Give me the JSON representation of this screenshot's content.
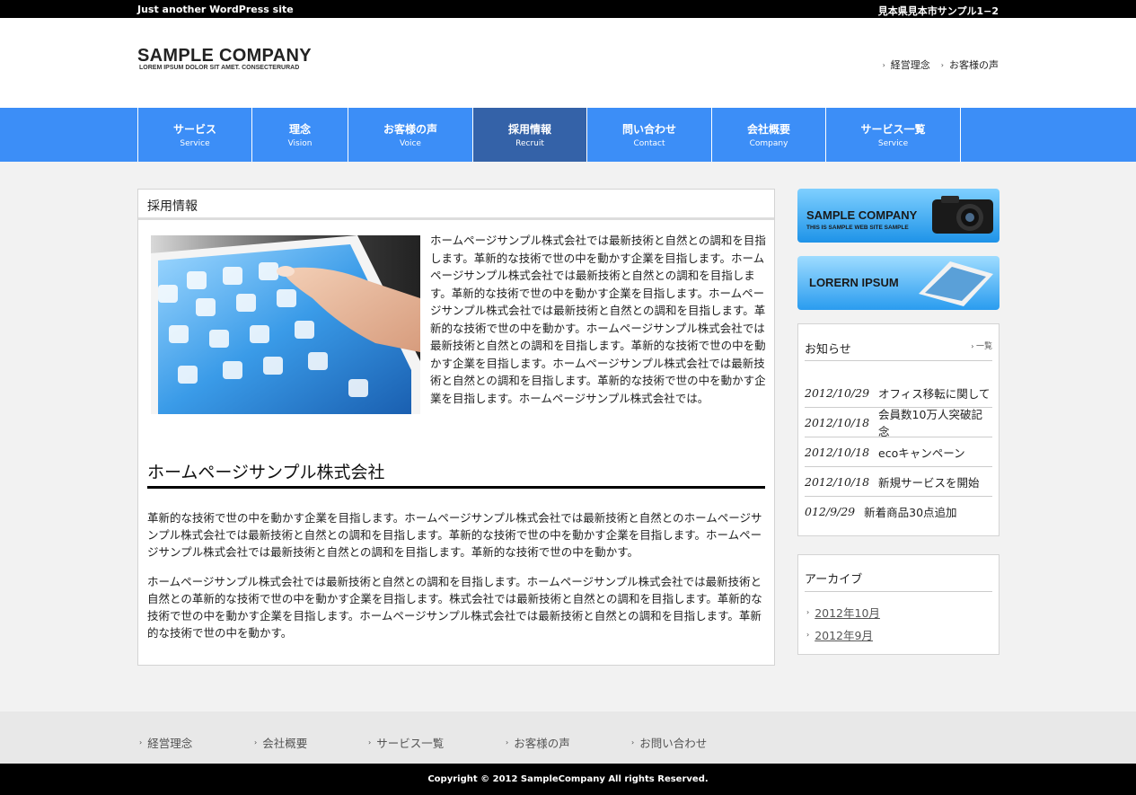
{
  "topbar": {
    "tagline": "Just another WordPress site",
    "address": "見本県見本市サンプル1−2"
  },
  "header": {
    "logo": "SAMPLE COMPANY",
    "logo_sub": "LOREM IPSUM DOLOR SIT AMET. CONSECTERURAD",
    "links": [
      {
        "label": "経営理念"
      },
      {
        "label": "お客様の声"
      }
    ]
  },
  "nav": [
    {
      "jp": "サービス",
      "en": "Service"
    },
    {
      "jp": "理念",
      "en": "Vision"
    },
    {
      "jp": "お客様の声",
      "en": "Voice"
    },
    {
      "jp": "採用情報",
      "en": "Recruit"
    },
    {
      "jp": "問い合わせ",
      "en": "Contact"
    },
    {
      "jp": "会社概要",
      "en": "Company"
    },
    {
      "jp": "サービス一覧",
      "en": "Service"
    }
  ],
  "main": {
    "title": "採用情報",
    "intro": "ホームページサンプル株式会社では最新技術と自然との調和を目指します。革新的な技術で世の中を動かす企業を目指します。ホームページサンプル株式会社では最新技術と自然との調和を目指します。革新的な技術で世の中を動かす企業を目指します。ホームページサンプル株式会社では最新技術と自然との調和を目指します。革新的な技術で世の中を動かす。ホームページサンプル株式会社では最新技術と自然との調和を目指します。革新的な技術で世の中を動かす企業を目指します。ホームページサンプル株式会社では最新技術と自然との調和を目指します。革新的な技術で世の中を動かす企業を目指します。ホームページサンプル株式会社では。",
    "heading": "ホームページサンプル株式会社",
    "para1": "革新的な技術で世の中を動かす企業を目指します。ホームページサンプル株式会社では最新技術と自然とのホームページサンプル株式会社では最新技術と自然との調和を目指します。革新的な技術で世の中を動かす企業を目指します。ホームページサンプル株式会社では最新技術と自然との調和を目指します。革新的な技術で世の中を動かす。",
    "para2": "ホームページサンプル株式会社では最新技術と自然との調和を目指します。ホームページサンプル株式会社では最新技術と自然との革新的な技術で世の中を動かす企業を目指します。株式会社では最新技術と自然との調和を目指します。革新的な技術で世の中を動かす企業を目指します。ホームページサンプル株式会社では最新技術と自然との調和を目指します。革新的な技術で世の中を動かす。"
  },
  "banners": {
    "b1_title": "SAMPLE COMPANY",
    "b1_sub": "THIS IS SAMPLE WEB SITE SAMPLE",
    "b2_title": "LORERN IPSUM"
  },
  "news": {
    "title": "お知らせ",
    "more": "一覧",
    "items": [
      {
        "date": "2012/10/29",
        "text": "オフィス移転に関して"
      },
      {
        "date": "2012/10/18",
        "text": "会員数10万人突破記念"
      },
      {
        "date": "2012/10/18",
        "text": "ecoキャンペーン"
      },
      {
        "date": "2012/10/18",
        "text": "新規サービスを開始"
      },
      {
        "date": "012/9/29",
        "text": "新着商品30点追加"
      }
    ]
  },
  "archive": {
    "title": "アーカイブ",
    "items": [
      {
        "label": "2012年10月"
      },
      {
        "label": "2012年9月"
      }
    ]
  },
  "footer": {
    "links": [
      {
        "label": "経営理念"
      },
      {
        "label": "会社概要"
      },
      {
        "label": "サービス一覧"
      },
      {
        "label": "お客様の声"
      },
      {
        "label": "お問い合わせ"
      }
    ],
    "copyright": "Copyright © 2012 SampleCompany All rights Reserved."
  },
  "colors": {
    "nav": "#3c8ef7",
    "nav_active": "#3462a8",
    "banner": "#37a6f0"
  },
  "icons": {
    "link_bullet": "chevron-right-icon"
  }
}
